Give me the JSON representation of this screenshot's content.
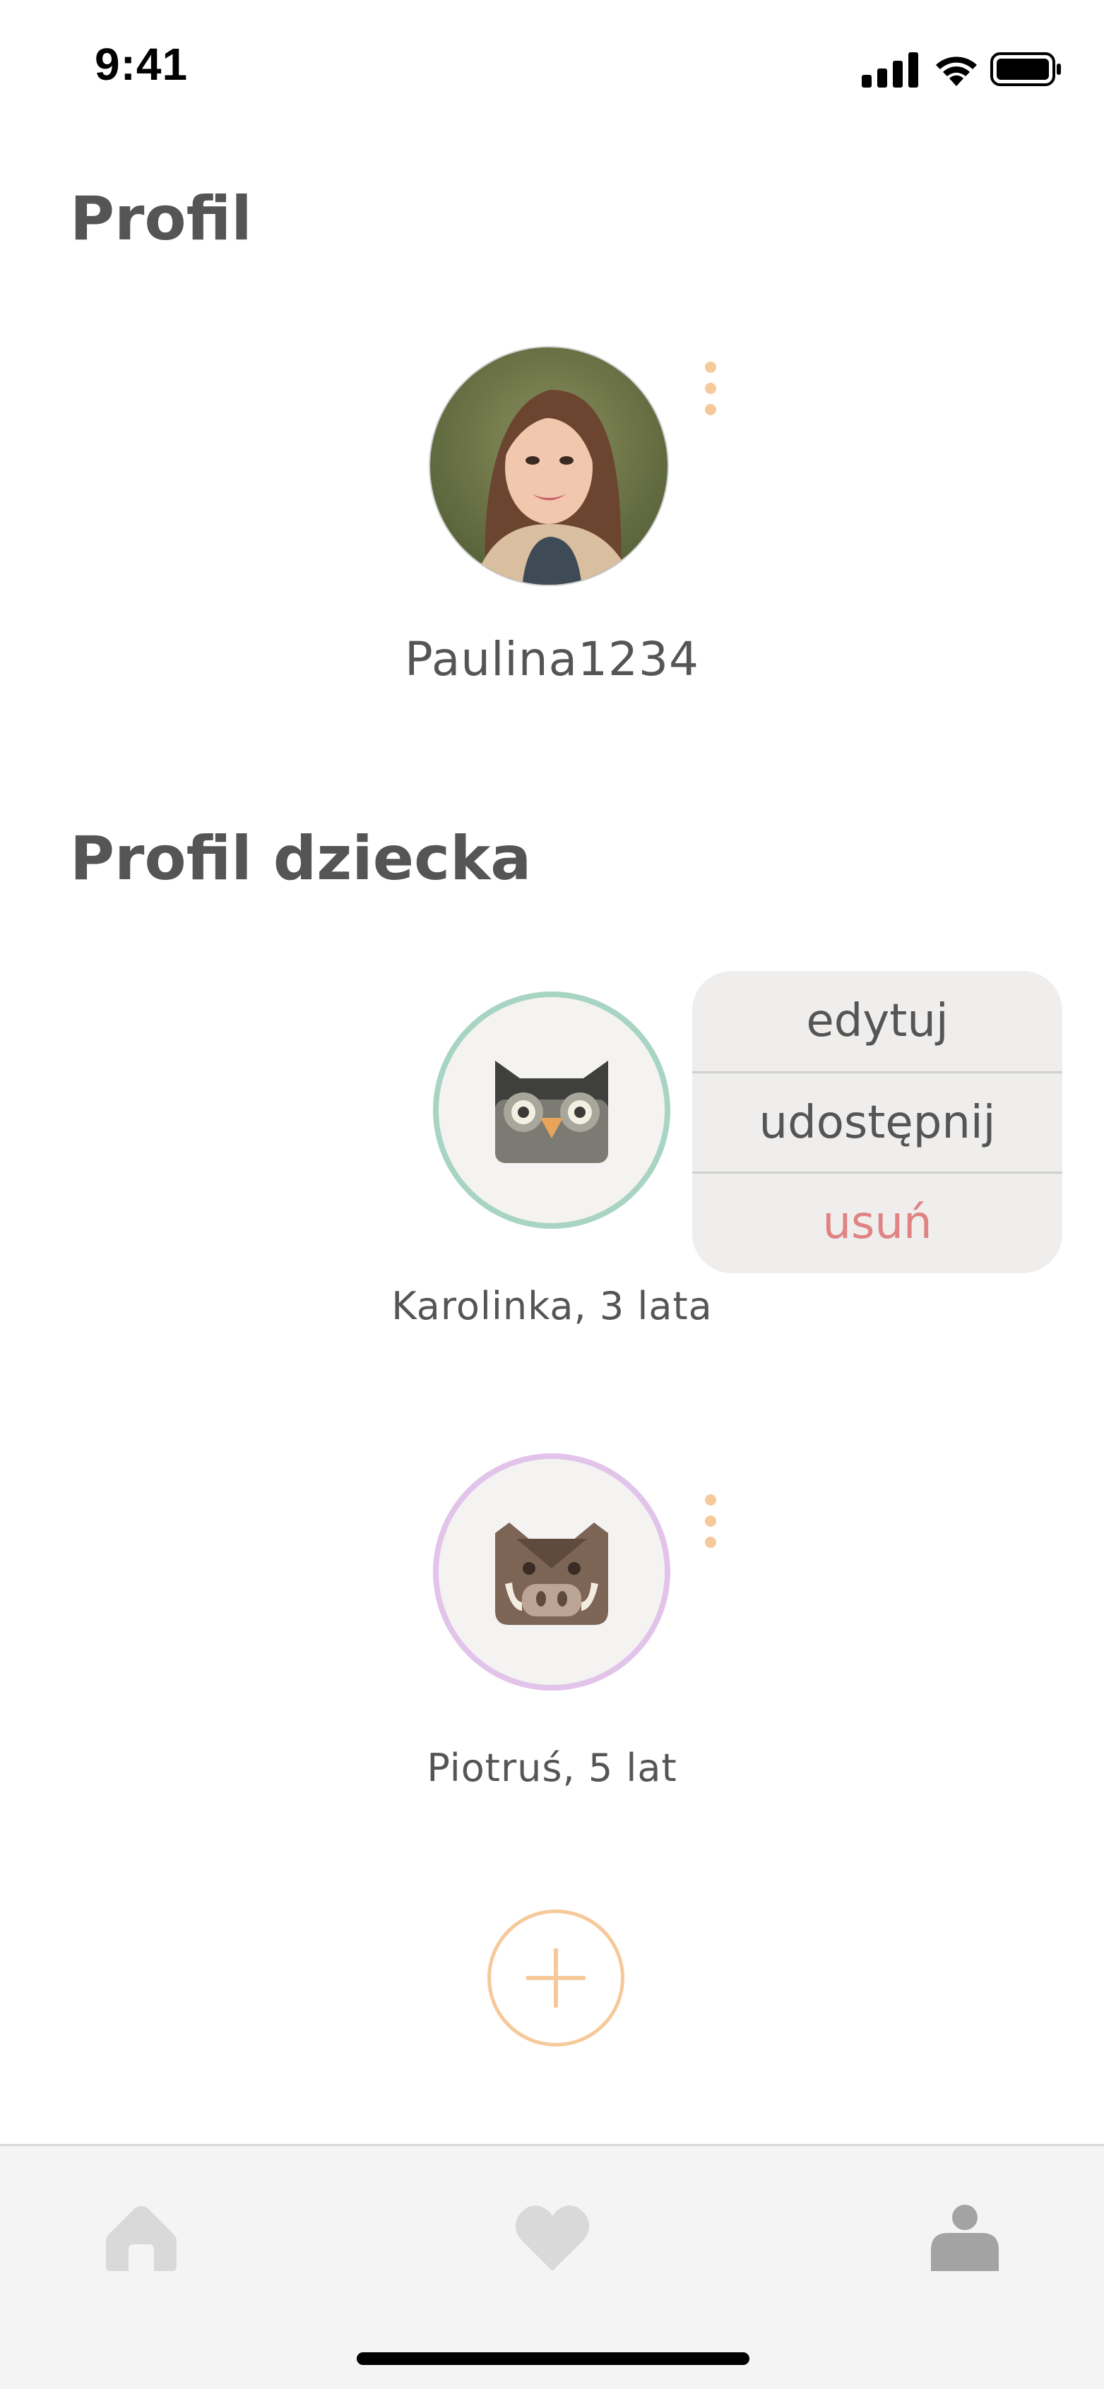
{
  "status_bar": {
    "time": "9:41",
    "icons": [
      "signal-icon",
      "wifi-icon",
      "battery-icon"
    ]
  },
  "profile": {
    "section_title": "Profil",
    "username": "Paulina1234",
    "avatar": "user-photo",
    "menu_icon": "kebab-menu-icon"
  },
  "children": {
    "section_title": "Profil dziecka",
    "items": [
      {
        "label": "Karolinka, 3 lata",
        "avatar_icon": "owl-icon",
        "ring_color": "#a8d4c3"
      },
      {
        "label": "Piotruś, 5 lat",
        "avatar_icon": "boar-icon",
        "ring_color": "#e2c4ea"
      }
    ]
  },
  "context_menu": {
    "items": [
      {
        "label": "edytuj"
      },
      {
        "label": "udostępnij"
      },
      {
        "label": "usuń"
      }
    ]
  },
  "add_button": {
    "icon": "plus-icon"
  },
  "tab_bar": {
    "tabs": [
      {
        "icon": "home-icon",
        "active": false
      },
      {
        "icon": "heart-icon",
        "active": false
      },
      {
        "icon": "person-icon",
        "active": true
      }
    ]
  },
  "colors": {
    "accent": "#f6c99a",
    "danger": "#e08383",
    "text": "#555555",
    "tab_inactive": "#d9d9d9",
    "tab_active": "#a3a3a3"
  }
}
